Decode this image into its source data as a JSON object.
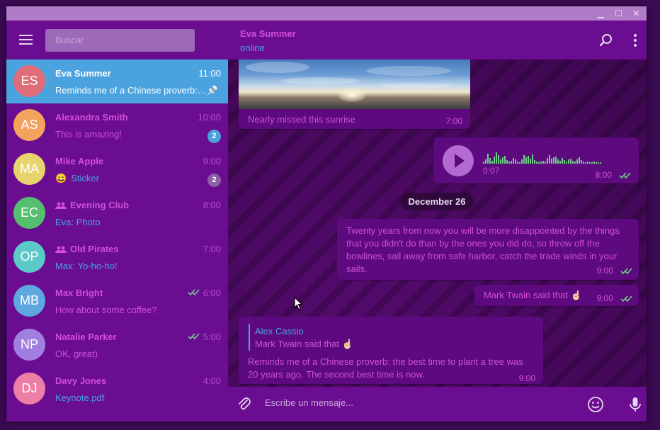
{
  "search": {
    "placeholder": "Buscar"
  },
  "chats": [
    {
      "initials": "ES",
      "name": "Eva Summer",
      "time": "11:00",
      "message": "Reminds me of a Chinese proverb: the best time to plant a tree",
      "avatar_color": "#e06c78",
      "active": true,
      "pinned": true
    },
    {
      "initials": "AS",
      "name": "Alexandra Smith",
      "time": "10:00",
      "message": "This is amazing!",
      "avatar_color": "#f5a25d",
      "badge": "2",
      "badge_color": "#4aa3df"
    },
    {
      "initials": "MA",
      "name": "Mike Apple",
      "time": "9:00",
      "emoji": "😄",
      "message": "Sticker",
      "avatar_color": "#e8d46c",
      "badge": "2",
      "badge_color": "#8b5ea6"
    },
    {
      "initials": "EC",
      "name": "Evening Club",
      "time": "8:00",
      "message": "Eva: Photo",
      "avatar_color": "#56bf6f",
      "group": true
    },
    {
      "initials": "OP",
      "name": "Old Pirates",
      "time": "7:00",
      "message": "Max: Yo-ho-ho!",
      "avatar_color": "#5cc9c9",
      "group": true
    },
    {
      "initials": "MB",
      "name": "Max Bright",
      "time": "6:00",
      "message": "How about some coffee?",
      "avatar_color": "#5fa7e0",
      "read": true
    },
    {
      "initials": "NP",
      "name": "Natalie Parker",
      "time": "5:00",
      "message": "OK, great)",
      "avatar_color": "#a07fe0",
      "read": true
    },
    {
      "initials": "DJ",
      "name": "Davy Jones",
      "time": "4:00",
      "message": "Keynote.pdf",
      "avatar_color": "#ed7ea6"
    }
  ],
  "header": {
    "name": "Eva Summer",
    "status": "online"
  },
  "messages": {
    "photo_caption": "Nearly missed this sunrise",
    "photo_time": "7:00",
    "voice_duration": "0:07",
    "voice_time": "8:00",
    "date_divider": "December 26",
    "quote_text": "Twenty years from now you will be more disappointed by the things that you didn't do than by the ones you did do, so throw off the bowlines, sail away from safe harbor, catch the trade winds in your sails.",
    "quote_time": "9:00",
    "twain_text": "Mark Twain said that ☝🏻",
    "twain_time": "9:00",
    "reply_name": "Alex Cassio",
    "reply_quote": "Mark Twain said that ☝🏻",
    "reply_text": "Reminds me of a Chinese proverb: the best time to plant a tree was 20 years ago. The second best time is now.",
    "reply_time": "9:00"
  },
  "composer": {
    "placeholder": "Escribe un mensaje..."
  },
  "colors": {
    "background": "#6a0d91",
    "accent": "#d24fd6",
    "link": "#4aa3df",
    "active": "#4aa3df",
    "titlebar": "#b07cc8"
  }
}
